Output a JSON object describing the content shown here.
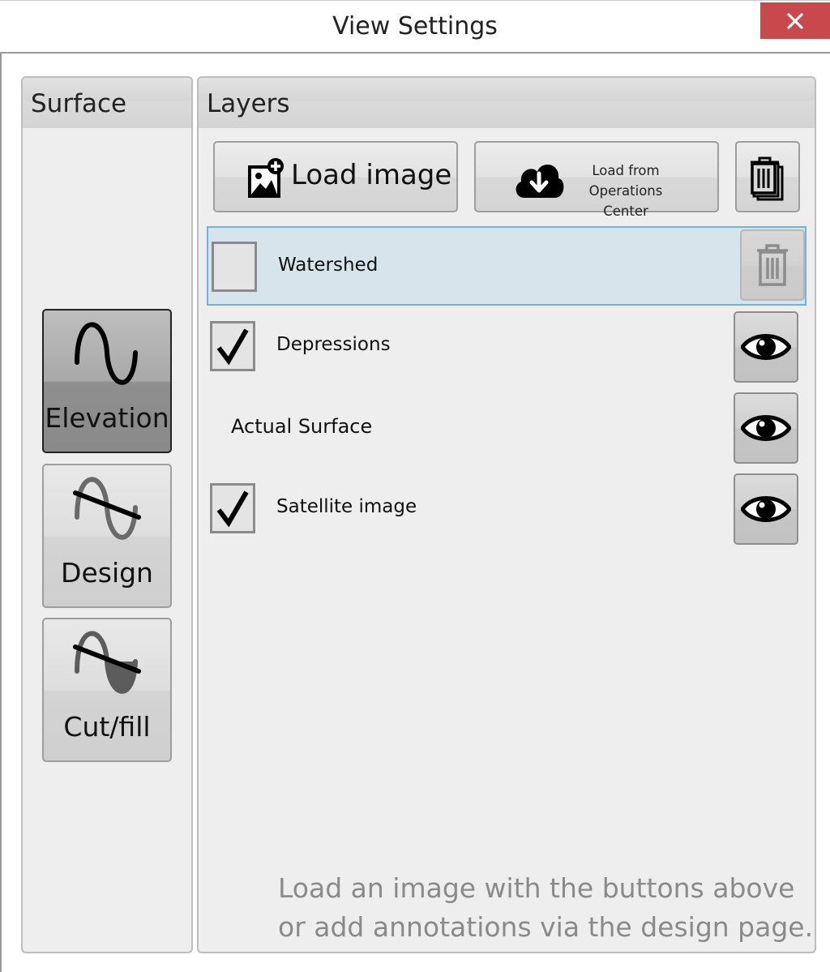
{
  "window": {
    "title": "View Settings",
    "close_icon": "×"
  },
  "surface": {
    "header": "Surface",
    "items": [
      {
        "label": "Elevation",
        "icon": "elevation-wave-icon",
        "active": true
      },
      {
        "label": "Design",
        "icon": "design-wave-icon",
        "active": false
      },
      {
        "label": "Cut/fill",
        "icon": "cutfill-wave-icon",
        "active": false
      }
    ]
  },
  "layers": {
    "header": "Layers",
    "toolbar": {
      "load_image_label": "Load image",
      "load_ops_line1": "Load from",
      "load_ops_line2": "Operations Center"
    },
    "rows": [
      {
        "label": "Watershed",
        "checked": false,
        "selected": true,
        "action": "delete-icon"
      },
      {
        "label": "Depressions",
        "checked": true,
        "selected": false,
        "action": "eye-icon"
      },
      {
        "label": "Actual Surface",
        "checked": null,
        "selected": false,
        "action": "eye-icon"
      },
      {
        "label": "Satellite image",
        "checked": true,
        "selected": false,
        "action": "eye-icon"
      }
    ],
    "hint_line1": "Load an image with the buttons above",
    "hint_line2": "or add annotations via the design page."
  },
  "colors": {
    "close_button": "#c9484b",
    "selected_row_bg": "#d7e4ec",
    "selected_row_border": "#6fb4de",
    "hint_text": "#8a8a8a"
  }
}
